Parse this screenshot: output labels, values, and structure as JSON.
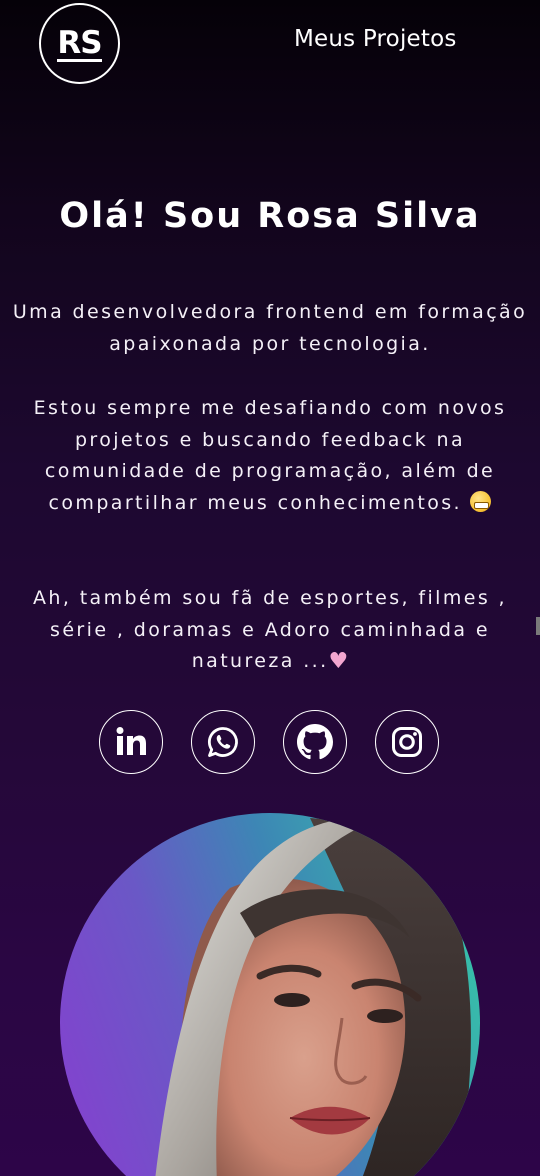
{
  "header": {
    "logo_text": "RS",
    "nav_link": "Meus Projetos"
  },
  "hero": {
    "title": "Olá! Sou Rosa Silva",
    "paragraph1": "Uma desenvolvedora frontend em formação apaixonada por tecnologia.",
    "paragraph2": "Estou sempre me desafiando com novos projetos e buscando feedback na comunidade de programação, além de compartilhar meus conhecimentos.",
    "paragraph3": "Ah, também sou fã de esportes, filmes , série , doramas e Adoro caminhada e natureza ...",
    "emoji_grin": "grinning-face-emoji",
    "emoji_heart": "pink-heart-emoji"
  },
  "socials": [
    {
      "name": "linkedin",
      "icon": "linkedin-icon"
    },
    {
      "name": "whatsapp",
      "icon": "whatsapp-icon"
    },
    {
      "name": "github",
      "icon": "github-icon"
    },
    {
      "name": "instagram",
      "icon": "instagram-icon"
    }
  ],
  "colors": {
    "background_top": "#050108",
    "background_bottom": "#2d0548",
    "text": "#ffffff",
    "avatar_ring_start": "#8a3cd1",
    "avatar_ring_end": "#35d1a6"
  }
}
